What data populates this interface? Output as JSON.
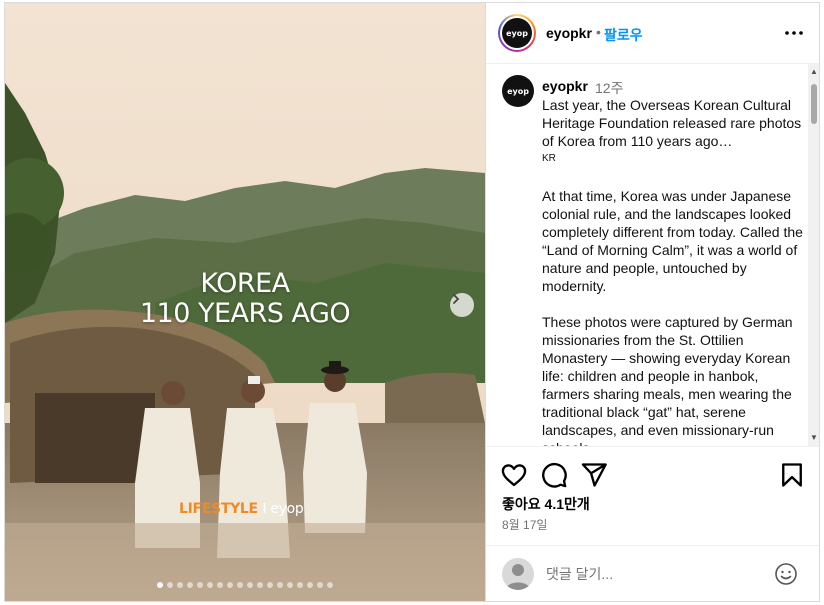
{
  "post": {
    "image": {
      "title_line1": "KOREA",
      "title_line2": "110 YEARS AGO",
      "brand_left": "LIFESTYLE",
      "brand_right": "I eyop",
      "slide_count": 18,
      "active_slide": 1
    },
    "header": {
      "avatar_text": "eyop",
      "username": "eyopkr",
      "separator": "•",
      "follow_label": "팔로우",
      "more_icon": "more-horizontal-icon"
    },
    "caption": {
      "avatar_text": "eyop",
      "username": "eyopkr",
      "time": "12주",
      "paragraph1": "Last year, the Overseas Korean Cultural Heritage Foundation released rare photos of Korea from 110 years ago…",
      "flag": "KR",
      "paragraph2": "At that time, Korea was under Japanese colonial rule, and the landscapes looked completely different from today. Called the “Land of Morning Calm”, it was a world of nature and people, untouched by modernity.",
      "paragraph3": "These photos were captured by German missionaries from the St. Ottilien Monastery — showing everyday Korean life: children and people in hanbok, farmers sharing meals, men wearing the traditional black “gat” hat, serene landscapes, and even missionary-run schools."
    },
    "actions": {
      "likes": "좋아요 4.1만개",
      "date": "8월 17일"
    },
    "comment": {
      "placeholder": "댓글 달기..."
    }
  }
}
